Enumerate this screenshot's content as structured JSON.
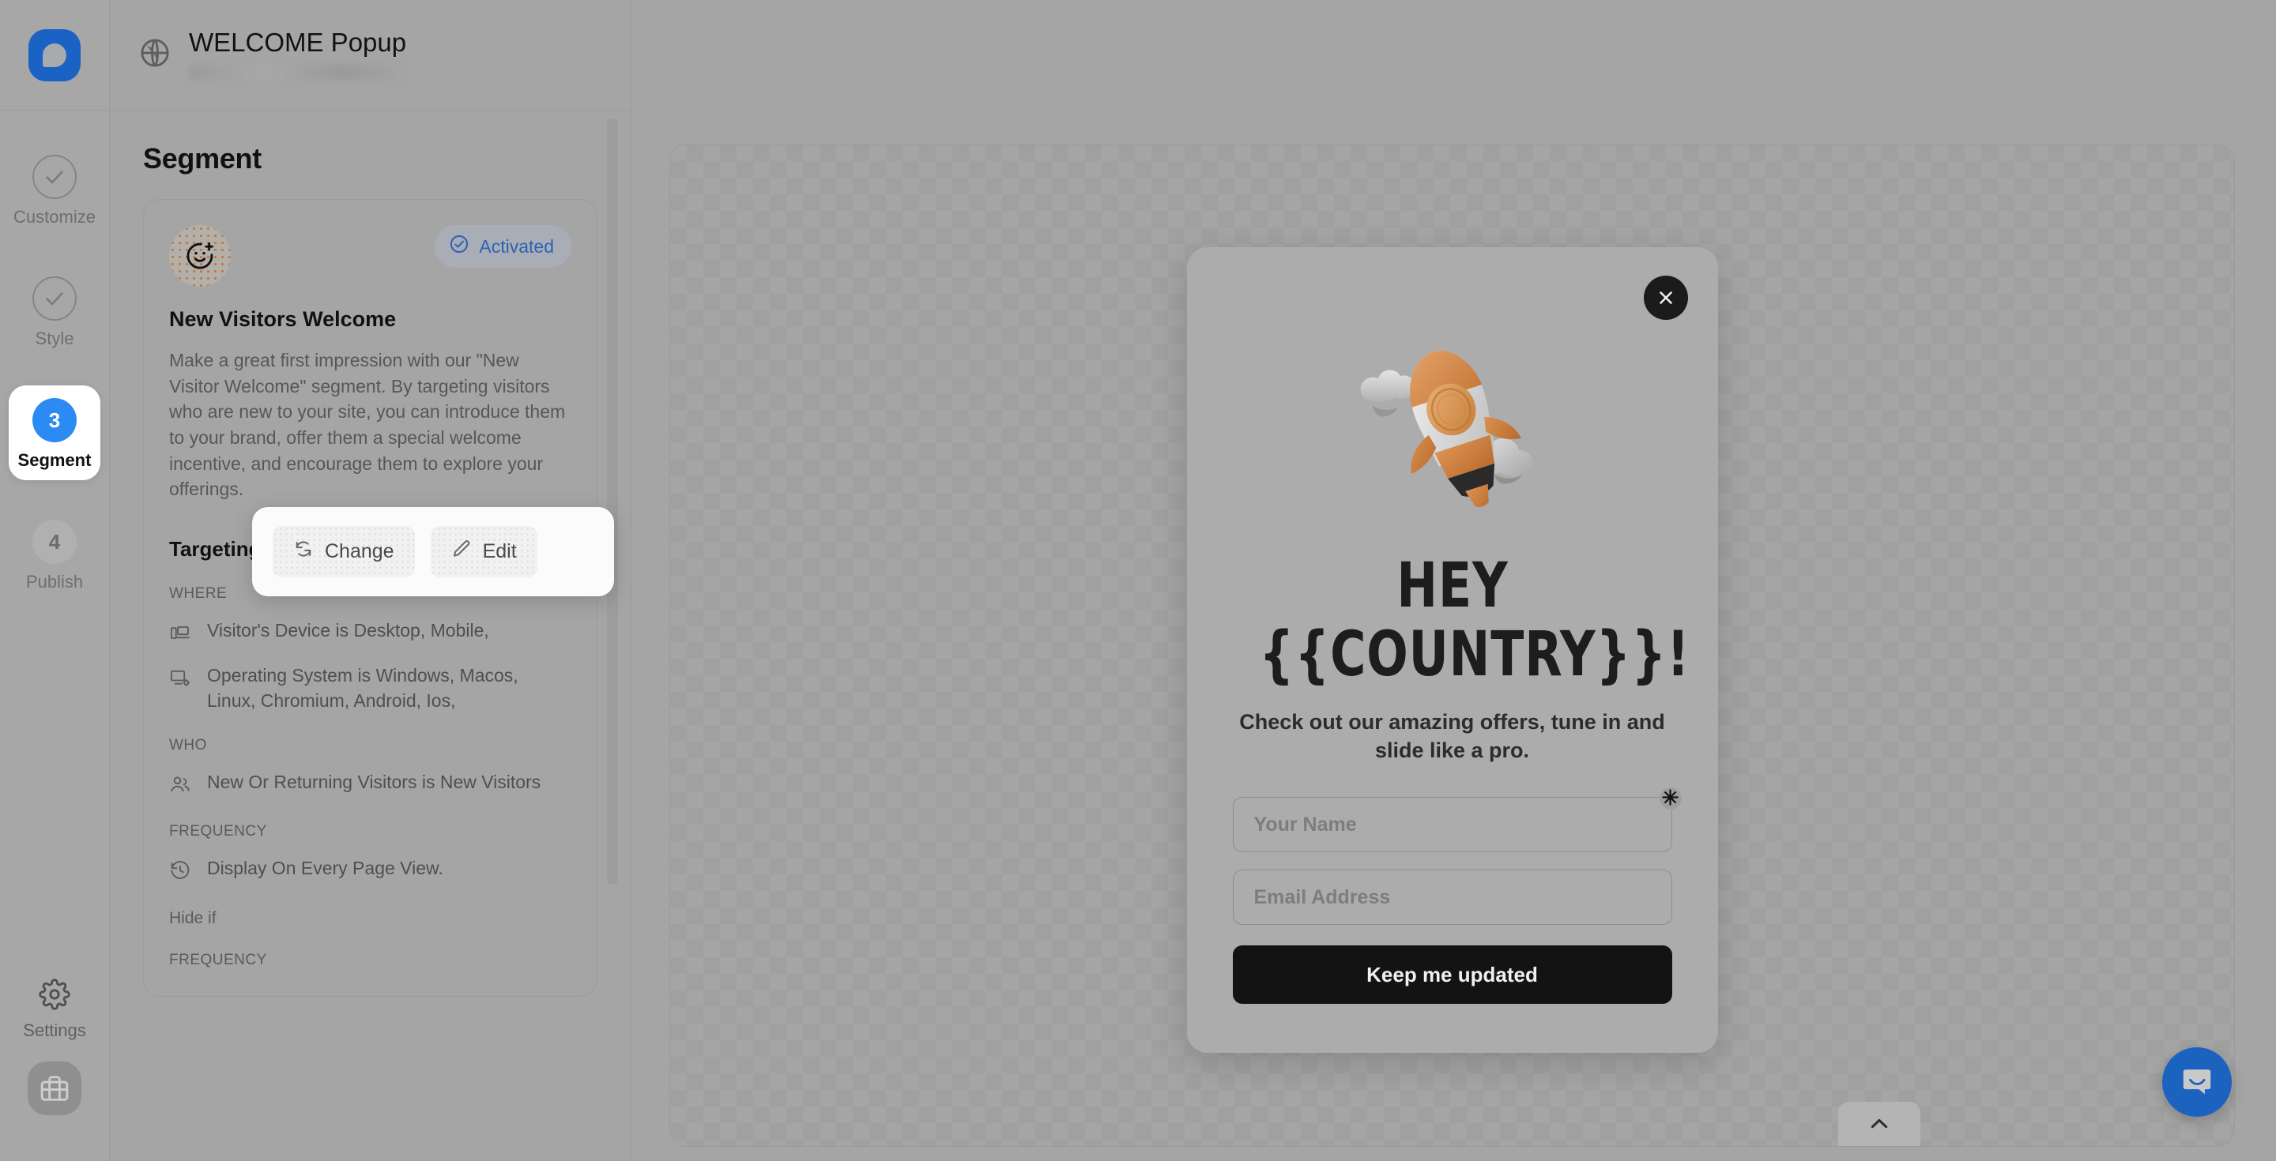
{
  "brand": {
    "logo_name": "popupsmart-logo",
    "accent": "#1a62c4"
  },
  "rail": {
    "steps": [
      {
        "label": "Customize",
        "state": "done",
        "badge": "check"
      },
      {
        "label": "Style",
        "state": "done",
        "badge": "check"
      },
      {
        "label": "Segment",
        "state": "current",
        "badge": "3"
      },
      {
        "label": "Publish",
        "state": "future",
        "badge": "4"
      }
    ],
    "settings_label": "Settings",
    "workspace_icon": "briefcase-icon"
  },
  "panel": {
    "header": {
      "title": "WELCOME Popup",
      "icon": "globe-icon"
    },
    "heading": "Segment",
    "card": {
      "avatar_icon": "smiley-plus-icon",
      "status_badge": {
        "label": "Activated",
        "icon": "check-circle-icon",
        "color": "#2e62b4"
      },
      "name": "New Visitors Welcome",
      "description": "Make a great first impression with our \"New Visitor Welcome\" segment. By targeting visitors who are new to your site, you can introduce them to your brand, offer them a special welcome incentive, and encourage them to explore your offerings."
    },
    "actions": {
      "change_label": "Change",
      "change_icon": "refresh-icon",
      "edit_label": "Edit",
      "edit_icon": "pencil-icon"
    },
    "targeting": {
      "heading": "Targeting Summary",
      "groups": [
        {
          "label": "WHERE",
          "rules": [
            {
              "icon": "devices-icon",
              "text": "Visitor's Device is Desktop, Mobile,"
            },
            {
              "icon": "monitor-gear-icon",
              "text": "Operating System is Windows, Macos, Linux, Chromium, Android, Ios,"
            }
          ]
        },
        {
          "label": "WHO",
          "rules": [
            {
              "icon": "users-icon",
              "text": "New Or Returning Visitors is New Visitors"
            }
          ]
        },
        {
          "label": "FREQUENCY",
          "rules": [
            {
              "icon": "history-icon",
              "text": "Display On Every Page View."
            }
          ]
        }
      ],
      "hide_if_label": "Hide if",
      "hide_if_group_label": "FREQUENCY"
    }
  },
  "preview": {
    "close_icon": "close-icon",
    "illustration": "rocket-3d-illustration",
    "headline_line1": "HEY",
    "headline_line2": "{{COUNTRY}}!",
    "subtext": "Check out our amazing offers, tune in and slide like a pro.",
    "fields": [
      {
        "name": "name-field",
        "placeholder": "Your Name",
        "value": "",
        "required": true
      },
      {
        "name": "email-field",
        "placeholder": "Email Address",
        "value": "",
        "required": false
      }
    ],
    "required_marker": "✳",
    "cta_label": "Keep me updated"
  },
  "chrome": {
    "collapse_tab_icon": "chevron-up-icon",
    "chat_launcher_icon": "intercom-chat-icon",
    "chat_launcher_color": "#1b63bf"
  }
}
